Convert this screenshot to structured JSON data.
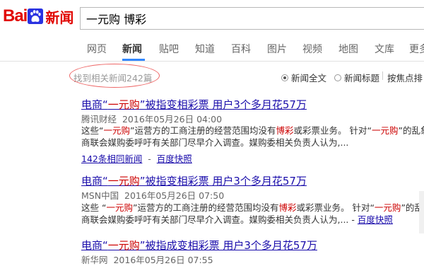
{
  "logo": {
    "part1": "Bai",
    "part2": "du",
    "part3": "新闻"
  },
  "search": {
    "query": "一元购 博彩"
  },
  "nav": {
    "tabs": [
      "网页",
      "新闻",
      "贴吧",
      "知道",
      "百科",
      "图片",
      "视频",
      "地图",
      "文库",
      "更多"
    ],
    "active": "新闻"
  },
  "results_info": {
    "count_text": "找到相关新闻242篇",
    "option_full": "新闻全文",
    "option_title": "新闻标题",
    "sort_text": "按焦点排"
  },
  "results": [
    {
      "title_pre": "电商“",
      "title_hl": "一元购",
      "title_post": "”被指变相彩票 用户3个多月花57万",
      "source": "腾讯财经",
      "date": "2016年05月26日 04:00",
      "abs1_a": "这些“",
      "abs1_hl1": "一元购",
      "abs1_b": "”运营方的工商注册的经营范围均没有",
      "abs1_hl2": "博彩",
      "abs1_c": "或彩票业务。 针对“",
      "abs1_hl3": "一元购",
      "abs1_d": "”的乱象,中",
      "abs2": "商联会媒购委呼吁有关部门尽早介入调查。媒购委相关负责人认为,...",
      "related": "142条相同新闻",
      "cache": "百度快照"
    },
    {
      "title_pre": "电商“",
      "title_hl": "一元购",
      "title_post": "”被指变相彩票 用户3个多月花57万",
      "source": "MSN中国",
      "date": "2016年05月26日 07:50",
      "abs1_a": "这些 “",
      "abs1_hl1": "一元购",
      "abs1_b": "”运营方的工商注册的经营范围均没有",
      "abs1_hl2": "博彩",
      "abs1_c": "或彩票业务。 针对“",
      "abs1_hl3": "一元购",
      "abs1_d": "”的乱象,中",
      "abs2": "商联会媒购委呼吁有关部门尽早介入调查。媒购委相关负责人认为,...",
      "cache": "百度快照"
    },
    {
      "title_pre": "电商“",
      "title_hl": "一元购",
      "title_post": "”被指成变相彩票 用户3个多月花57万",
      "source": "新华网",
      "date": "2016年05月26日 07:55"
    }
  ],
  "colors": {
    "brand": "#e10602",
    "link": "#1a0dab",
    "highlight": "#cc0000",
    "tab_underline": "#3388ff"
  }
}
